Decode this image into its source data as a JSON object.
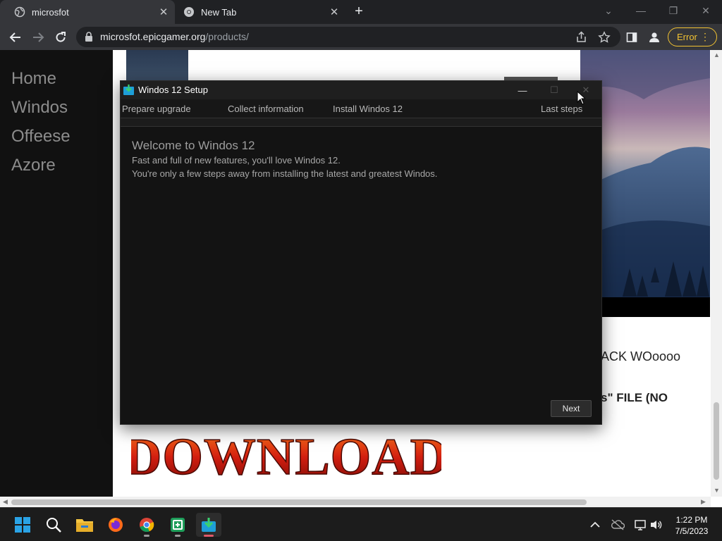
{
  "browser": {
    "tabs": [
      {
        "title": "microsfot",
        "active": true
      },
      {
        "title": "New Tab",
        "active": false
      }
    ],
    "url_host": "microsfot.epicgamer.org",
    "url_path": "/products/",
    "profile_status": "Error"
  },
  "page": {
    "nav": [
      "Home",
      "Windos",
      "Offeese",
      "Azore"
    ],
    "text_line1": "ACK WOoooo",
    "text_line2": "s\" FILE (NO",
    "download_label": "DOWNLOAD"
  },
  "setup_window": {
    "title": "Windos 12 Setup",
    "steps": [
      "Prepare upgrade",
      "Collect information",
      "Install Windos 12",
      "Last steps"
    ],
    "heading": "Welcome to Windos 12",
    "line1": "Fast and full of new features, you'll love Windos 12.",
    "line2": "You're only a few steps away from installing the latest and greatest Windos.",
    "next_label": "Next"
  },
  "taskbar": {
    "apps": [
      "start-icon",
      "search-icon",
      "file-explorer-icon",
      "firefox-icon",
      "chrome-icon",
      "green-app-icon",
      "setup-download-icon"
    ],
    "time": "1:22 PM",
    "date": "7/5/2023"
  },
  "colors": {
    "accent_error": "#f1c232",
    "sidenav_bg": "#111111",
    "dialog_bg": "#131313"
  }
}
